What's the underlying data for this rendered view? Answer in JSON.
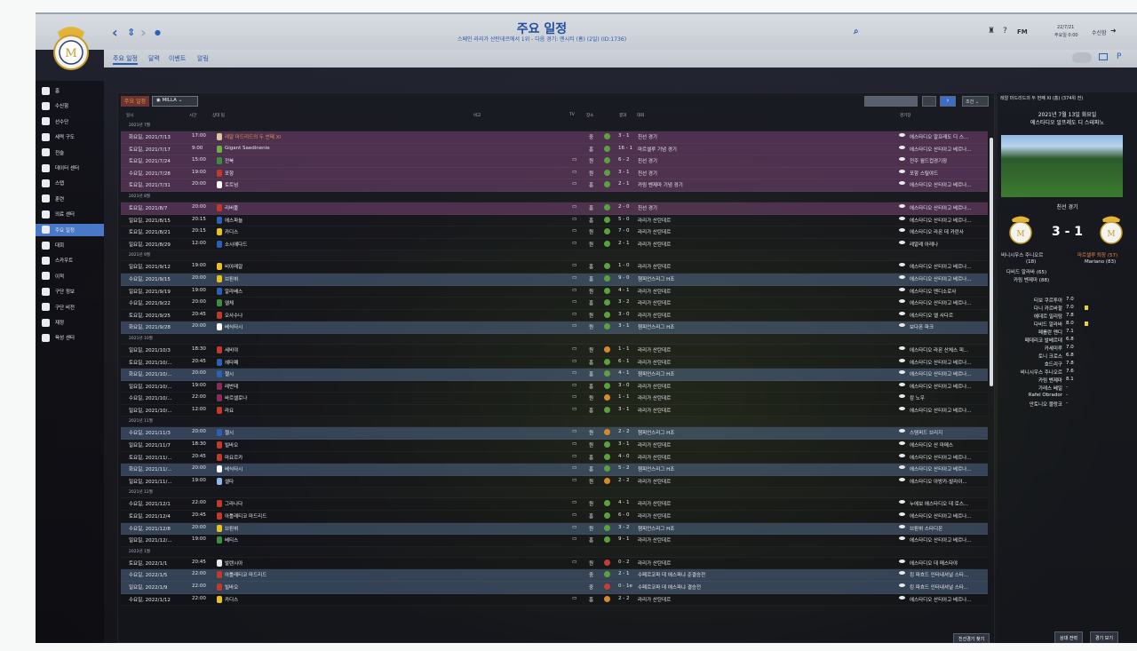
{
  "header": {
    "title": "주요 일정",
    "subtitle": "스페인 라리가 산탄데르에서 1위 - 다음 경기: 맨시티 (홈) (2일) (ID:1736)",
    "date": "22/7/21",
    "date_sub": "주요일 0:00",
    "continue_label": "수신함",
    "fm_label": "FM"
  },
  "tabs": [
    "주요 일정",
    "달력",
    "이벤트",
    "알림"
  ],
  "sidebar": [
    {
      "label": "홈",
      "icon": "home-icon"
    },
    {
      "label": "수신함",
      "icon": "inbox-icon"
    },
    {
      "label": "선수단",
      "icon": "squad-icon"
    },
    {
      "label": "세력 구도",
      "icon": "dynamics-icon"
    },
    {
      "label": "전술",
      "icon": "tactics-icon"
    },
    {
      "label": "데이터 센터",
      "icon": "data-icon"
    },
    {
      "label": "스탭",
      "icon": "staff-icon"
    },
    {
      "label": "훈련",
      "icon": "training-icon"
    },
    {
      "label": "의료 센터",
      "icon": "medical-icon"
    },
    {
      "label": "주요 일정",
      "icon": "calendar-icon"
    },
    {
      "label": "대회",
      "icon": "trophy-icon"
    },
    {
      "label": "스카우트",
      "icon": "scout-icon"
    },
    {
      "label": "이적",
      "icon": "transfer-icon"
    },
    {
      "label": "구단 정보",
      "icon": "club-icon"
    },
    {
      "label": "구단 비전",
      "icon": "vision-icon"
    },
    {
      "label": "재정",
      "icon": "finance-icon"
    },
    {
      "label": "육성 센터",
      "icon": "youth-icon"
    }
  ],
  "main": {
    "title": "주요 일정",
    "filter": "MILLA",
    "view_select": "",
    "filter_select": "조건",
    "columns": {
      "date": "일시",
      "time": "시간",
      "opponent": "상대 팀",
      "notes": "비고",
      "tv": "TV",
      "venue": "장소",
      "result": "결과",
      "competition": "대회",
      "stadium": "경기장"
    },
    "bottom_button": "친선경기 찾기"
  },
  "rows": [
    {
      "type": "month",
      "label": "2021년 7월"
    },
    {
      "type": "match",
      "date": "화요일, 2021/7/13",
      "time": "17:00",
      "opp": "레알 마드리드의 두 번째 XI",
      "opp_color": "#e8894a",
      "badge": "#d9c89b",
      "tv": "",
      "venue": "중",
      "res": "g",
      "score": "3 - 1",
      "comp": "친선 경기",
      "stad": "에스타디오 알프레도 디 스...",
      "tone": "t-purple"
    },
    {
      "type": "match",
      "date": "토요일, 2021/7/17",
      "time": "9:00",
      "opp": "Gigant Saedinenie",
      "badge": "#6fae4a",
      "tv": "",
      "venue": "홈",
      "res": "g",
      "score": "16 - 1",
      "comp": "마르셀루 기념 경기",
      "stad": "에스타디오 산티아고 베르나...",
      "tone": "t-purple"
    },
    {
      "type": "match",
      "date": "토요일, 2021/7/24",
      "time": "15:00",
      "opp": "전북",
      "badge": "#3e8c43",
      "tv": "▭",
      "venue": "원",
      "res": "g",
      "score": "6 - 2",
      "comp": "친선 경기",
      "stad": "전주 월드컵경기장",
      "tone": "t-purple"
    },
    {
      "type": "match",
      "date": "수요일, 2021/7/28",
      "time": "19:00",
      "opp": "포항",
      "badge": "#c0392b",
      "tv": "▭",
      "venue": "원",
      "res": "g",
      "score": "3 - 1",
      "comp": "친선 경기",
      "stad": "포항 스틸야드",
      "tone": "t-purple"
    },
    {
      "type": "match",
      "date": "토요일, 2021/7/31",
      "time": "20:00",
      "opp": "토트넘",
      "badge": "#ffffff",
      "tv": "▭",
      "venue": "홈",
      "res": "g",
      "score": "2 - 1",
      "comp": "카림 벤제마 기념 경기",
      "stad": "에스타디오 산티아고 베르나...",
      "tone": "t-purple"
    },
    {
      "type": "month",
      "label": "2021년 8월"
    },
    {
      "type": "match",
      "date": "토요일, 2021/8/7",
      "time": "20:00",
      "opp": "리버풀",
      "badge": "#c0392b",
      "tv": "▭",
      "venue": "홈",
      "res": "g",
      "score": "2 - 0",
      "comp": "친선 경기",
      "stad": "에스타디오 산티아고 베르나...",
      "tone": "t-purple"
    },
    {
      "type": "match",
      "date": "일요일, 2021/8/15",
      "time": "20:15",
      "opp": "에스파뇰",
      "badge": "#2c5fb5",
      "tv": "▭",
      "venue": "홈",
      "res": "g",
      "score": "5 - 0",
      "comp": "라리가 산탄데르",
      "stad": "에스타디오 산티아고 베르나...",
      "tone": "t-plain"
    },
    {
      "type": "match",
      "date": "토요일, 2021/8/21",
      "time": "20:15",
      "opp": "카디스",
      "badge": "#e6c31e",
      "tv": "▭",
      "venue": "원",
      "res": "g",
      "score": "7 - 0",
      "comp": "라리가 산탄데르",
      "stad": "에스타디오 라몬 데 카란사",
      "tone": "t-plain"
    },
    {
      "type": "match",
      "date": "일요일, 2021/8/29",
      "time": "12:00",
      "opp": "소시에다드",
      "badge": "#2c5fb5",
      "tv": "▭",
      "venue": "원",
      "res": "g",
      "score": "2 - 1",
      "comp": "라리가 산탄데르",
      "stad": "레알레 아레나",
      "tone": "t-plain"
    },
    {
      "type": "month",
      "label": "2021년 9월"
    },
    {
      "type": "match",
      "date": "일요일, 2021/9/12",
      "time": "19:00",
      "opp": "비야레알",
      "badge": "#e6c31e",
      "tv": "▭",
      "venue": "홈",
      "res": "g",
      "score": "1 - 0",
      "comp": "라리가 산탄데르",
      "stad": "에스타디오 산티아고 베르나...",
      "tone": "t-plain"
    },
    {
      "type": "match",
      "date": "수요일, 2021/9/15",
      "time": "20:00",
      "opp": "브뢴뷔",
      "badge": "#e6c31e",
      "tv": "▭",
      "venue": "홈",
      "res": "g",
      "score": "9 - 0",
      "comp": "챔피언스리그 H조",
      "stad": "에스타디오 산티아고 베르나...",
      "tone": "t-blue"
    },
    {
      "type": "match",
      "date": "일요일, 2021/9/19",
      "time": "19:00",
      "opp": "알라베스",
      "badge": "#2c5fb5",
      "tv": "▭",
      "venue": "원",
      "res": "g",
      "score": "4 - 1",
      "comp": "라리가 산탄데르",
      "stad": "에스타디오 멘디소로사",
      "tone": "t-plain"
    },
    {
      "type": "match",
      "date": "수요일, 2021/9/22",
      "time": "20:00",
      "opp": "엘체",
      "badge": "#3e8c43",
      "tv": "▭",
      "venue": "홈",
      "res": "g",
      "score": "3 - 2",
      "comp": "라리가 산탄데르",
      "stad": "에스타디오 산티아고 베르나...",
      "tone": "t-plain"
    },
    {
      "type": "match",
      "date": "토요일, 2021/9/25",
      "time": "20:45",
      "opp": "오사수나",
      "badge": "#c0392b",
      "tv": "▭",
      "venue": "원",
      "res": "g",
      "score": "3 - 0",
      "comp": "라리가 산탄데르",
      "stad": "에스타디오 엘 사다르",
      "tone": "t-plain"
    },
    {
      "type": "match",
      "date": "화요일, 2021/9/28",
      "time": "20:00",
      "opp": "베식타시",
      "badge": "#ffffff",
      "tv": "▭",
      "venue": "원",
      "res": "g",
      "score": "3 - 1",
      "comp": "챔피언스리그 H조",
      "stad": "보다폰 파크",
      "tone": "t-blue"
    },
    {
      "type": "month",
      "label": "2021년 10월"
    },
    {
      "type": "match",
      "date": "일요일, 2021/10/3",
      "time": "18:30",
      "opp": "세비야",
      "badge": "#c0392b",
      "tv": "▭",
      "venue": "원",
      "res": "o",
      "score": "1 - 1",
      "comp": "라리가 산탄데르",
      "stad": "에스타디오 라몬 산체스 피...",
      "tone": "t-plain"
    },
    {
      "type": "match",
      "date": "토요일, 2021/10/...",
      "time": "20:45",
      "opp": "헤타페",
      "badge": "#2c5fb5",
      "tv": "▭",
      "venue": "홈",
      "res": "g",
      "score": "6 - 1",
      "comp": "라리가 산탄데르",
      "stad": "에스타디오 산티아고 베르나...",
      "tone": "t-plain"
    },
    {
      "type": "match",
      "date": "화요일, 2021/10/...",
      "time": "20:00",
      "opp": "첼시",
      "badge": "#2c5fb5",
      "tv": "▭",
      "venue": "홈",
      "res": "g",
      "score": "4 - 1",
      "comp": "챔피언스리그 H조",
      "stad": "에스타디오 산티아고 베르나...",
      "tone": "t-blue"
    },
    {
      "type": "match",
      "date": "일요일, 2021/10/...",
      "time": "19:00",
      "opp": "레반테",
      "badge": "#8a2b5c",
      "tv": "▭",
      "venue": "홈",
      "res": "g",
      "score": "3 - 0",
      "comp": "라리가 산탄데르",
      "stad": "에스타디오 산티아고 베르나...",
      "tone": "t-plain"
    },
    {
      "type": "match",
      "date": "수요일, 2021/10/...",
      "time": "22:00",
      "opp": "바르셀로나",
      "badge": "#8a2b5c",
      "tv": "▭",
      "venue": "원",
      "res": "o",
      "score": "1 - 1",
      "comp": "라리가 산탄데르",
      "stad": "캄 노우",
      "tone": "t-plain"
    },
    {
      "type": "match",
      "date": "일요일, 2021/10/...",
      "time": "12:00",
      "opp": "라요",
      "badge": "#c0392b",
      "tv": "▭",
      "venue": "홈",
      "res": "g",
      "score": "3 - 1",
      "comp": "라리가 산탄데르",
      "stad": "에스타디오 산티아고 베르나...",
      "tone": "t-plain"
    },
    {
      "type": "month",
      "label": "2021년 11월"
    },
    {
      "type": "match",
      "date": "수요일, 2021/11/3",
      "time": "20:00",
      "opp": "첼시",
      "badge": "#2c5fb5",
      "tv": "▭",
      "venue": "원",
      "res": "o",
      "score": "2 - 2",
      "comp": "챔피언스리그 H조",
      "stad": "스탬퍼드 브리지",
      "tone": "t-blue"
    },
    {
      "type": "match",
      "date": "일요일, 2021/11/7",
      "time": "18:30",
      "opp": "빌바오",
      "badge": "#c0392b",
      "tv": "▭",
      "venue": "원",
      "res": "g",
      "score": "3 - 1",
      "comp": "라리가 산탄데르",
      "stad": "에스타디오 산 마메스",
      "tone": "t-plain"
    },
    {
      "type": "match",
      "date": "토요일, 2021/11/...",
      "time": "20:45",
      "opp": "마요르카",
      "badge": "#c0392b",
      "tv": "▭",
      "venue": "홈",
      "res": "g",
      "score": "4 - 0",
      "comp": "라리가 산탄데르",
      "stad": "에스타디오 산티아고 베르나...",
      "tone": "t-plain"
    },
    {
      "type": "match",
      "date": "화요일, 2021/11/...",
      "time": "20:00",
      "opp": "베식타시",
      "badge": "#ffffff",
      "tv": "▭",
      "venue": "홈",
      "res": "g",
      "score": "5 - 2",
      "comp": "챔피언스리그 H조",
      "stad": "에스타디오 산티아고 베르나...",
      "tone": "t-blue"
    },
    {
      "type": "match",
      "date": "일요일, 2021/11/...",
      "time": "19:00",
      "opp": "셀타",
      "badge": "#8fb8e4",
      "tv": "▭",
      "venue": "원",
      "res": "o",
      "score": "2 - 2",
      "comp": "라리가 산탄데르",
      "stad": "에스타디오 아방카-발라이...",
      "tone": "t-plain"
    },
    {
      "type": "month",
      "label": "2021년 12월"
    },
    {
      "type": "match",
      "date": "수요일, 2021/12/1",
      "time": "22:00",
      "opp": "그라나다",
      "badge": "#c0392b",
      "tv": "▭",
      "venue": "원",
      "res": "g",
      "score": "4 - 1",
      "comp": "라리가 산탄데르",
      "stad": "누에보 에스타디오 데 로스...",
      "tone": "t-plain"
    },
    {
      "type": "match",
      "date": "토요일, 2021/12/4",
      "time": "20:45",
      "opp": "아틀레티코 마드리드",
      "badge": "#c0392b",
      "tv": "▭",
      "venue": "홈",
      "res": "g",
      "score": "6 - 0",
      "comp": "라리가 산탄데르",
      "stad": "에스타디오 산티아고 베르나...",
      "tone": "t-plain"
    },
    {
      "type": "match",
      "date": "수요일, 2021/12/8",
      "time": "20:00",
      "opp": "브뢴뷔",
      "badge": "#e6c31e",
      "tv": "▭",
      "venue": "원",
      "res": "g",
      "score": "3 - 2",
      "comp": "챔피언스리그 H조",
      "stad": "브뢴뷔 스타디온",
      "tone": "t-blue"
    },
    {
      "type": "match",
      "date": "일요일, 2021/12/...",
      "time": "19:00",
      "opp": "베티스",
      "badge": "#3e8c43",
      "tv": "▭",
      "venue": "홈",
      "res": "g",
      "score": "9 - 1",
      "comp": "라리가 산탄데르",
      "stad": "에스타디오 산티아고 베르나...",
      "tone": "t-plain"
    },
    {
      "type": "month",
      "label": "2022년 1월"
    },
    {
      "type": "match",
      "date": "토요일, 2022/1/1",
      "time": "20:45",
      "opp": "발렌시아",
      "badge": "#e8e8e8",
      "tv": "▭",
      "venue": "원",
      "res": "r",
      "score": "0 - 2",
      "comp": "라리가 산탄데르",
      "stad": "에스타디오 데 메스타야",
      "tone": "t-plain"
    },
    {
      "type": "match",
      "date": "수요일, 2022/1/5",
      "time": "22:00",
      "opp": "아틀레티코 마드리드",
      "badge": "#c0392b",
      "tv": "",
      "venue": "중",
      "res": "g",
      "score": "2 - 1",
      "comp": "수페르코파 데 에스파냐 준결승전",
      "stad": "킹 파흐드 인터내셔널 스타...",
      "tone": "t-blue"
    },
    {
      "type": "match",
      "date": "일요일, 2022/1/9",
      "time": "22:00",
      "opp": "빌바오",
      "badge": "#c0392b",
      "tv": "",
      "venue": "중",
      "res": "r",
      "score": "0 - 1e",
      "comp": "수페르코파 데 에스파냐 결승전",
      "stad": "킹 파흐드 인터내셔널 스타...",
      "tone": "t-blue"
    },
    {
      "type": "match",
      "date": "수요일, 2022/1/12",
      "time": "22:00",
      "opp": "카디스",
      "badge": "#e6c31e",
      "tv": "▭",
      "venue": "홈",
      "res": "o",
      "score": "2 - 2",
      "comp": "라리가 산탄데르",
      "stad": "에스타디오 산티아고 베르나...",
      "tone": "t-plain"
    }
  ],
  "right": {
    "heading": "레알 마드리드의 두 번째 XI (홈) (374위 전)",
    "date": "2021년 7월 13일 화요일",
    "stadium": "에스타디오 알프레도 디 스테파노",
    "competition": "친선 경기",
    "score": "3 - 1",
    "home_scorer": "비니시우스 주니오르",
    "home_scorer_min": "(18)",
    "home_scorer2": "다비드 알라바 (65)",
    "home_scorer3": "카림 벤제마 (88)",
    "away_name": "마르셀루 퇴장 (57)",
    "away_scorer": "Mariano (83)",
    "lineup": [
      {
        "name": "티보 쿠르투아",
        "rating": "7.0",
        "ev": ""
      },
      {
        "name": "다니 카르바할",
        "rating": "7.0",
        "ev": "yel"
      },
      {
        "name": "에데르 밀리탕",
        "rating": "7.8",
        "ev": ""
      },
      {
        "name": "다비드 알라바",
        "rating": "8.0",
        "ev": "yel"
      },
      {
        "name": "페를란 멘디",
        "rating": "7.1",
        "ev": ""
      },
      {
        "name": "페데리코 발베르데",
        "rating": "6.8",
        "ev": ""
      },
      {
        "name": "카세미루",
        "rating": "7.0",
        "ev": ""
      },
      {
        "name": "토니 크로스",
        "rating": "6.8",
        "ev": ""
      },
      {
        "name": "호드리구",
        "rating": "7.8",
        "ev": ""
      },
      {
        "name": "비니시우스 주니오르",
        "rating": "7.6",
        "ev": ""
      },
      {
        "name": "카림 벤제마",
        "rating": "8.1",
        "ev": ""
      },
      {
        "name": "가레스 베일",
        "rating": "-",
        "ev": ""
      },
      {
        "name": "Rafel Obrador",
        "rating": "-",
        "ev": ""
      },
      {
        "name": "안토니오 블랑코",
        "rating": "-",
        "ev": ""
      }
    ],
    "btn_pre": "상대 전력",
    "btn_view": "경기 보기"
  },
  "colors": {
    "win": "#5aa23e",
    "draw": "#d88a2a",
    "loss": "#c53d34",
    "accent": "#2c5fb5"
  }
}
